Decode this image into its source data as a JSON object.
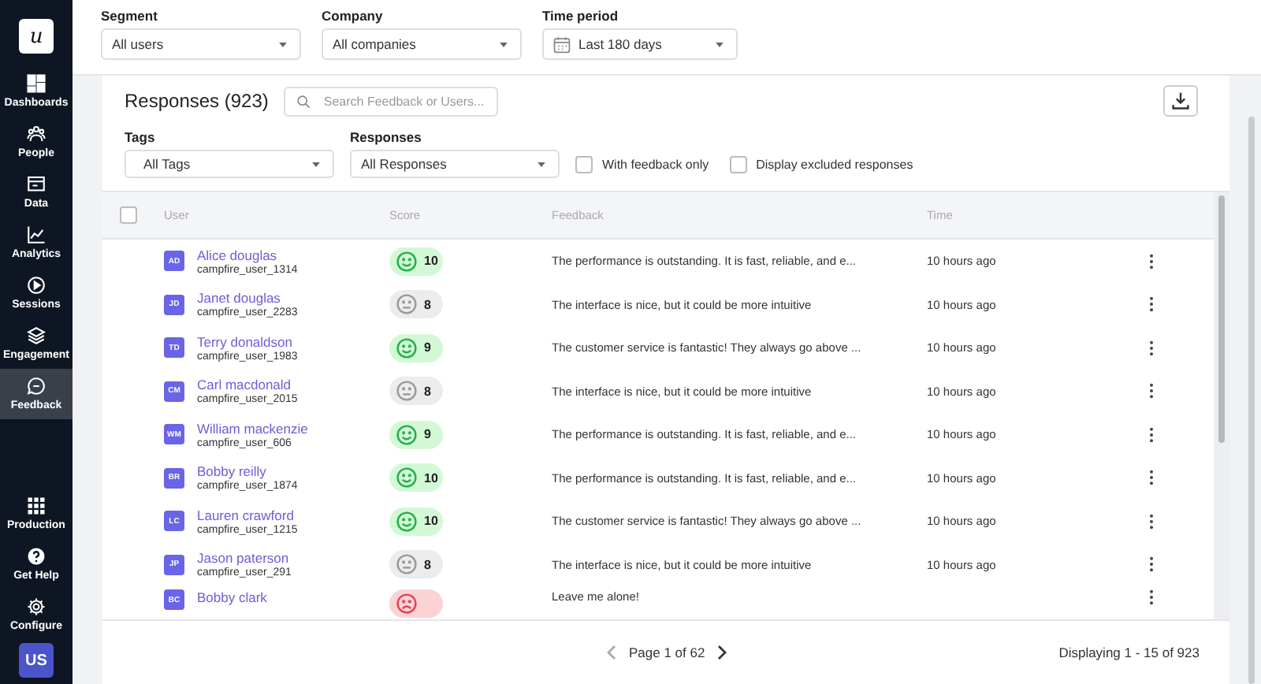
{
  "sidebar": {
    "logo": "u",
    "items": [
      {
        "label": "Dashboards",
        "selected": false
      },
      {
        "label": "People",
        "selected": false
      },
      {
        "label": "Data",
        "selected": false
      },
      {
        "label": "Analytics",
        "selected": false
      },
      {
        "label": "Sessions",
        "selected": false
      },
      {
        "label": "Engagement",
        "selected": false
      },
      {
        "label": "Feedback",
        "selected": true
      }
    ],
    "bottom_items": [
      {
        "label": "Production"
      },
      {
        "label": "Get Help"
      },
      {
        "label": "Configure"
      }
    ],
    "avatar": "US"
  },
  "filters": [
    {
      "label": "Segment",
      "value": "All users"
    },
    {
      "label": "Company",
      "value": "All companies"
    },
    {
      "label": "Time period",
      "value": "Last 180 days"
    }
  ],
  "title": "Responses (923)",
  "search": {
    "placeholder": "Search Feedback or Users..."
  },
  "tags": {
    "label": "Tags",
    "value": "All Tags"
  },
  "responses": {
    "label": "Responses",
    "value": "All Responses"
  },
  "options": [
    {
      "label": "With feedback only",
      "checked": false
    },
    {
      "label": "Display excluded responses",
      "checked": false
    }
  ],
  "table": {
    "select_all": false,
    "columns": [
      "User",
      "Score",
      "Feedback",
      "Time"
    ],
    "rows": [
      {
        "initials": "AD",
        "name": "Alice douglas",
        "username": "campfire_user_1314",
        "kind": "happy",
        "score": "10",
        "feedback": "The performance is outstanding. It is fast, reliable, and e...",
        "time": "10 hours ago"
      },
      {
        "initials": "JD",
        "name": "Janet douglas",
        "username": "campfire_user_2283",
        "kind": "neutral",
        "score": "8",
        "feedback": "The interface is nice, but it could be more intuitive",
        "time": "10 hours ago"
      },
      {
        "initials": "TD",
        "name": "Terry donaldson",
        "username": "campfire_user_1983",
        "kind": "happy",
        "score": "9",
        "feedback": "The customer service is fantastic! They always go above ...",
        "time": "10 hours ago"
      },
      {
        "initials": "CM",
        "name": "Carl macdonald",
        "username": "campfire_user_2015",
        "kind": "neutral",
        "score": "8",
        "feedback": "The interface is nice, but it could be more intuitive",
        "time": "10 hours ago"
      },
      {
        "initials": "WM",
        "name": "William mackenzie",
        "username": "campfire_user_606",
        "kind": "happy",
        "score": "9",
        "feedback": "The performance is outstanding. It is fast, reliable, and e...",
        "time": "10 hours ago"
      },
      {
        "initials": "BR",
        "name": "Bobby reilly",
        "username": "campfire_user_1874",
        "kind": "happy",
        "score": "10",
        "feedback": "The performance is outstanding. It is fast, reliable, and e...",
        "time": "10 hours ago"
      },
      {
        "initials": "LC",
        "name": "Lauren crawford",
        "username": "campfire_user_1215",
        "kind": "happy",
        "score": "10",
        "feedback": "The customer service is fantastic! They always go above ...",
        "time": "10 hours ago"
      },
      {
        "initials": "JP",
        "name": "Jason paterson",
        "username": "campfire_user_291",
        "kind": "neutral",
        "score": "8",
        "feedback": "The interface is nice, but it could be more intuitive",
        "time": "10 hours ago"
      },
      {
        "initials": "BC",
        "name": "Bobby clark",
        "kind": "sad",
        "feedback": "Leave me alone!"
      }
    ]
  },
  "pagination": {
    "page": "Page 1 of 62",
    "displaying": "Displaying 1 - 15 of 923"
  }
}
